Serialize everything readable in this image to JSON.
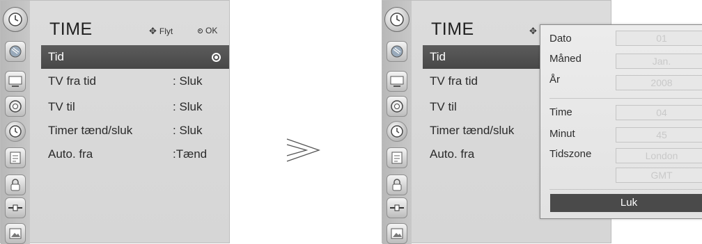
{
  "left_screen": {
    "title": "TIME",
    "hint_move_icon": "four-way-arrow-icon",
    "hint_move": "Flyt",
    "hint_ok_icon": "ok-dot-icon",
    "hint_ok": "OK",
    "sidebar_icons": [
      "clock-icon",
      "satellite-dish-icon",
      "monitor-icon",
      "speaker-icon",
      "clock-icon",
      "schedule-icon",
      "lock-icon",
      "input-plug-icon",
      "photo-icon"
    ],
    "items": [
      {
        "label": "Tid",
        "value": "",
        "selected": true
      },
      {
        "label": "TV fra tid",
        "value": ": Sluk"
      },
      {
        "label": "TV til",
        "value": ": Sluk"
      },
      {
        "label": "Timer tænd/sluk",
        "value": ": Sluk"
      },
      {
        "label": "Auto. fra",
        "value": ":Tænd"
      }
    ]
  },
  "arrow_icon": "double-chevron-right-icon",
  "right_screen": {
    "title": "TIME",
    "items": [
      {
        "label": "Tid"
      },
      {
        "label": "TV fra tid"
      },
      {
        "label": "TV til"
      },
      {
        "label": "Timer tænd/sluk"
      },
      {
        "label": "Auto. fra"
      }
    ]
  },
  "popup": {
    "date_label": "Dato",
    "date_value": "01",
    "month_label": "Måned",
    "month_value": "Jan.",
    "year_label": "År",
    "year_value": "2008",
    "hour_label": "Time",
    "hour_value": "04",
    "minute_label": "Minut",
    "minute_value": "45",
    "timezone_label": "Tidszone",
    "timezone_city": "London",
    "timezone_offset": "GMT",
    "close_label": "Luk"
  },
  "colors": {
    "selected_row": "#4f4f4f",
    "screen_bg": "#d8d8d8",
    "popup_bg": "#e8e8e8",
    "close_button": "#4a4a4a"
  }
}
